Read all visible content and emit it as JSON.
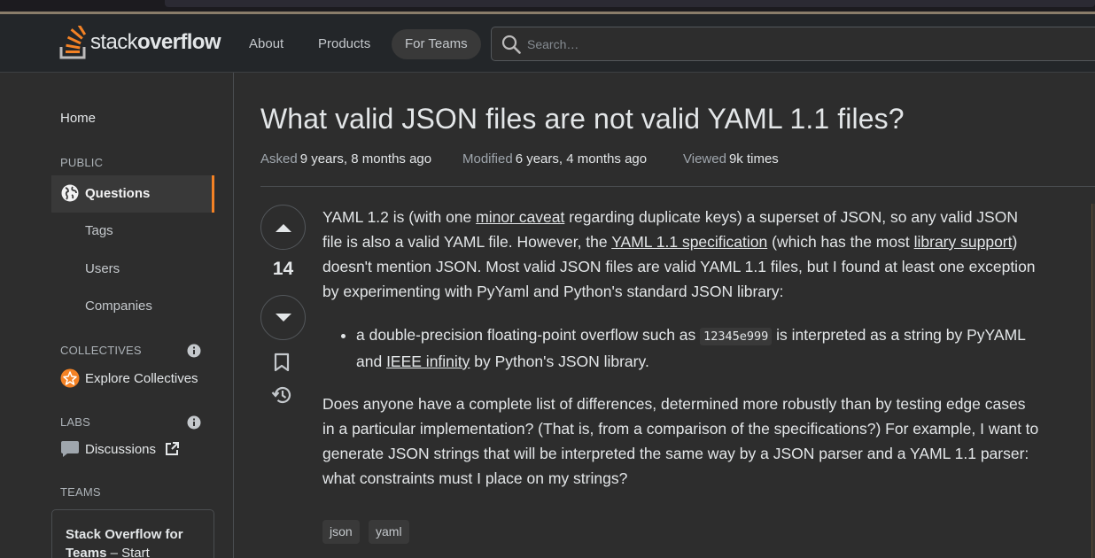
{
  "colors": {
    "accent": "#f48225",
    "background": "#2d2d2d",
    "topbar": "#232629",
    "text": "#e3e6e8"
  },
  "header": {
    "logo_light": "stack",
    "logo_bold": "overflow",
    "nav": {
      "about": "About",
      "products": "Products",
      "for_teams": "For Teams"
    },
    "search_placeholder": "Search…"
  },
  "sidebar": {
    "home": "Home",
    "public_label": "PUBLIC",
    "questions": "Questions",
    "tags": "Tags",
    "users": "Users",
    "companies": "Companies",
    "collectives_label": "COLLECTIVES",
    "explore_collectives": "Explore Collectives",
    "labs_label": "LABS",
    "discussions": "Discussions",
    "teams_label": "TEAMS",
    "teams_card_bold": "Stack Overflow for Teams",
    "teams_card_rest": " – Start"
  },
  "question": {
    "title": "What valid JSON files are not valid YAML 1.1 files?",
    "asked_label": "Asked",
    "asked_value": "9 years, 8 months ago",
    "modified_label": "Modified",
    "modified_value": "6 years, 4 months ago",
    "viewed_label": "Viewed",
    "viewed_value": "9k times",
    "votes": "14",
    "body": {
      "p1_a": "YAML 1.2 is (with one ",
      "p1_link1": "minor caveat",
      "p1_b": " regarding duplicate keys) a superset of JSON, so any valid JSON file is also a valid YAML file. However, the ",
      "p1_link2": "YAML 1.1 specification",
      "p1_c": " (which has the most ",
      "p1_link3": "library support",
      "p1_d": ") doesn't mention JSON. Most valid JSON files are valid YAML 1.1 files, but I found at least one exception by experimenting with PyYaml and Python's standard JSON library:",
      "li_a": "a double-precision floating-point overflow such as ",
      "li_code": "12345e999",
      "li_b": " is interpreted as a string by PyYAML and ",
      "li_link": "IEEE infinity",
      "li_c": " by Python's JSON library.",
      "p2": "Does anyone have a complete list of differences, determined more robustly than by testing edge cases in a particular implementation? (That is, from a comparison of the specifications?) For example, I want to generate JSON strings that will be interpreted the same way by a JSON parser and a YAML 1.1 parser: what constraints must I place on my strings?"
    },
    "tags": [
      "json",
      "yaml"
    ]
  }
}
